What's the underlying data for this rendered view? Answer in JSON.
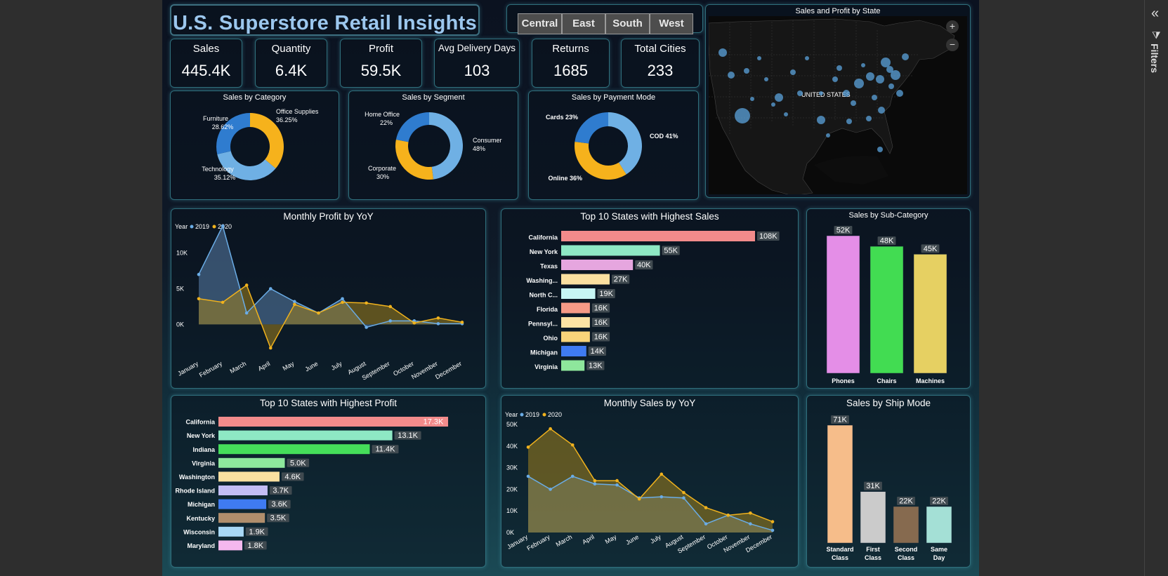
{
  "report": {
    "title": "U.S.  Superstore Retail Insights",
    "region_slicer": [
      "Central",
      "East",
      "South",
      "West"
    ]
  },
  "kpis": [
    {
      "label": "Sales",
      "value": "445.4K"
    },
    {
      "label": "Quantity",
      "value": "6.4K"
    },
    {
      "label": "Profit",
      "value": "59.5K"
    },
    {
      "label": "Avg Delivery Days",
      "value": "103"
    },
    {
      "label": "Returns",
      "value": "1685"
    },
    {
      "label": "Total Cities",
      "value": "233"
    }
  ],
  "filters_pane": {
    "label": "Filters",
    "collapse_icon": "double-chevron-left-icon",
    "funnel_icon": "funnel-icon"
  },
  "map": {
    "title": "Sales and Profit by State",
    "country_label": "UNITED STATES",
    "zoom_in": "+",
    "zoom_out": "−",
    "bubble_color": "#5ba3dc"
  },
  "colors": {
    "blue_dark": "#2f7ccf",
    "blue_light": "#6fb0e4",
    "orange": "#f6b21c",
    "line2019": "#6aace6",
    "line2020": "#f0b21d"
  },
  "chart_data": [
    {
      "id": "sales_by_category",
      "type": "pie",
      "title": "Sales by Category",
      "slices": [
        {
          "label": "Office Supplies",
          "pct_label": "36.25%",
          "value": 36.25,
          "color": "#f6b21c"
        },
        {
          "label": "Technology",
          "pct_label": "35.12%",
          "value": 35.12,
          "color": "#6fb0e4"
        },
        {
          "label": "Furniture",
          "pct_label": "28.62%",
          "value": 28.62,
          "color": "#2f7ccf"
        }
      ]
    },
    {
      "id": "sales_by_segment",
      "type": "pie",
      "title": "Sales by Segment",
      "slices": [
        {
          "label": "Consumer",
          "pct_label": "48%",
          "value": 48,
          "color": "#6fb0e4"
        },
        {
          "label": "Corporate",
          "pct_label": "30%",
          "value": 30,
          "color": "#f6b21c"
        },
        {
          "label": "Home Office",
          "pct_label": "22%",
          "value": 22,
          "color": "#2f7ccf"
        }
      ]
    },
    {
      "id": "sales_by_payment_mode",
      "type": "pie",
      "title": "Sales by Payment Mode",
      "slices": [
        {
          "label": "COD",
          "pct_label": "41%",
          "value": 41,
          "color": "#6fb0e4"
        },
        {
          "label": "Online",
          "pct_label": "36%",
          "value": 36,
          "color": "#f6b21c"
        },
        {
          "label": "Cards",
          "pct_label": "23%",
          "value": 23,
          "color": "#2f7ccf"
        }
      ]
    },
    {
      "id": "monthly_profit_yoy",
      "type": "area",
      "title": "Monthly Profit by YoY",
      "legend_title": "Year",
      "categories": [
        "January",
        "February",
        "March",
        "April",
        "May",
        "June",
        "July",
        "August",
        "September",
        "October",
        "November",
        "December"
      ],
      "y_ticks": [
        "0K",
        "5K",
        "10K"
      ],
      "ylim": [
        -3500,
        14000
      ],
      "series": [
        {
          "name": "2019",
          "values": [
            7000,
            13800,
            1600,
            5000,
            3200,
            1600,
            3600,
            -400,
            500,
            500,
            100,
            100
          ]
        },
        {
          "name": "2020",
          "values": [
            3600,
            3100,
            5500,
            -3300,
            2800,
            1600,
            3100,
            3000,
            2500,
            200,
            900,
            300
          ]
        }
      ]
    },
    {
      "id": "top10_states_sales",
      "type": "bar",
      "title": "Top 10 States with Highest Sales",
      "orientation": "horizontal",
      "categories": [
        "California",
        "New York",
        "Texas",
        "Washing...",
        "North C...",
        "Florida",
        "Pennsyl...",
        "Ohio",
        "Michigan",
        "Virginia"
      ],
      "values": [
        108,
        55,
        40,
        27,
        19,
        16,
        16,
        16,
        14,
        13
      ],
      "labels": [
        "108K",
        "55K",
        "40K",
        "27K",
        "19K",
        "16K",
        "16K",
        "16K",
        "14K",
        "13K"
      ],
      "colors": [
        "#f28b8b",
        "#8ee8c4",
        "#e6a6df",
        "#fbe0a0",
        "#c7f6f4",
        "#f59a86",
        "#fce3a4",
        "#f8d47a",
        "#3f7bf2",
        "#8ee79c"
      ]
    },
    {
      "id": "sales_by_subcategory",
      "type": "bar",
      "title": "Sales by Sub-Category",
      "categories": [
        "Phones",
        "Chairs",
        "Machines"
      ],
      "values": [
        52,
        48,
        45
      ],
      "labels": [
        "52K",
        "48K",
        "45K"
      ],
      "colors": [
        "#e48ee7",
        "#42dc52",
        "#e6d062"
      ]
    },
    {
      "id": "top10_states_profit",
      "type": "bar",
      "title": "Top 10 States with Highest Profit",
      "orientation": "horizontal",
      "categories": [
        "California",
        "New York",
        "Indiana",
        "Virginia",
        "Washington",
        "Rhode Island",
        "Michigan",
        "Kentucky",
        "Wisconsin",
        "Maryland"
      ],
      "values": [
        17.3,
        13.1,
        11.4,
        5.0,
        4.6,
        3.7,
        3.6,
        3.5,
        1.9,
        1.8
      ],
      "labels": [
        "17.3K",
        "13.1K",
        "11.4K",
        "5.0K",
        "4.6K",
        "3.7K",
        "3.6K",
        "3.5K",
        "1.9K",
        "1.8K"
      ],
      "colors": [
        "#f28b8b",
        "#8ee8c4",
        "#45de5a",
        "#8ee79c",
        "#fbe0a0",
        "#c3bdf5",
        "#3f7bf2",
        "#b08e6c",
        "#a8d8f6",
        "#f4b8ee"
      ]
    },
    {
      "id": "monthly_sales_yoy",
      "type": "area",
      "title": "Monthly Sales by YoY",
      "legend_title": "Year",
      "categories": [
        "January",
        "February",
        "March",
        "April",
        "May",
        "June",
        "July",
        "August",
        "September",
        "October",
        "November",
        "December"
      ],
      "y_ticks": [
        "0K",
        "10K",
        "20K",
        "30K",
        "40K",
        "50K"
      ],
      "ylim": [
        0,
        50000
      ],
      "series": [
        {
          "name": "2019",
          "values": [
            26000,
            20000,
            26000,
            22500,
            22000,
            16000,
            16500,
            16000,
            4000,
            8000,
            4000,
            1000
          ]
        },
        {
          "name": "2020",
          "values": [
            39500,
            48000,
            40500,
            24000,
            24000,
            15500,
            27000,
            18500,
            11500,
            8000,
            9000,
            5000
          ]
        }
      ]
    },
    {
      "id": "sales_by_ship_mode",
      "type": "bar",
      "title": "Sales by Ship Mode",
      "categories": [
        "Standard Class",
        "First Class",
        "Second Class",
        "Same Day"
      ],
      "values": [
        71,
        31,
        22,
        22
      ],
      "labels": [
        "71K",
        "31K",
        "22K",
        "22K"
      ],
      "colors": [
        "#f6bd8a",
        "#cbcbcb",
        "#866a4f",
        "#a4e0d6"
      ]
    }
  ]
}
